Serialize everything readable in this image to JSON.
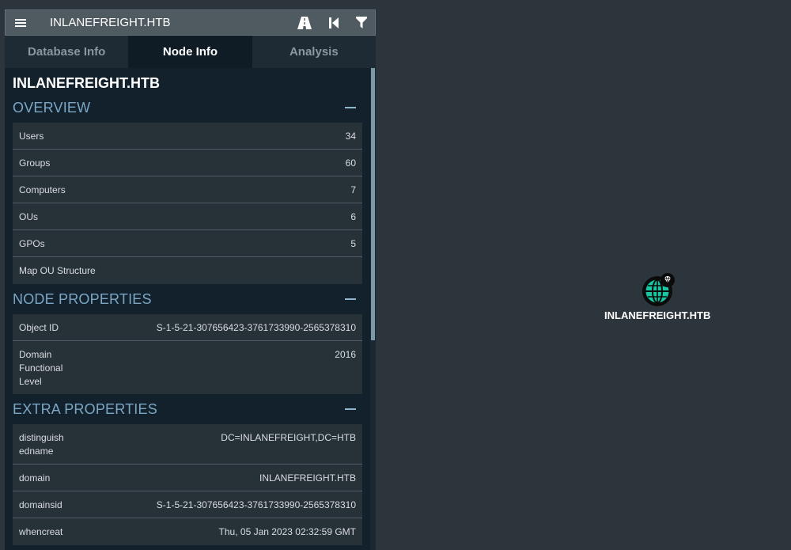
{
  "header": {
    "title": "INLANEFREIGHT.HTB",
    "icons": [
      "menu-icon",
      "path-finding-icon",
      "back-icon",
      "filter-icon"
    ]
  },
  "tabs": [
    {
      "label": "Database Info",
      "active": false
    },
    {
      "label": "Node Info",
      "active": true
    },
    {
      "label": "Analysis",
      "active": false
    }
  ],
  "node": {
    "name": "INLANEFREIGHT.HTB",
    "overview": {
      "header": "OVERVIEW",
      "rows": [
        {
          "label": "Users",
          "value": "34"
        },
        {
          "label": "Groups",
          "value": "60"
        },
        {
          "label": "Computers",
          "value": "7"
        },
        {
          "label": "OUs",
          "value": "6"
        },
        {
          "label": "GPOs",
          "value": "5"
        },
        {
          "label": "Map OU Structure",
          "value": ""
        }
      ]
    },
    "node_properties": {
      "header": "NODE PROPERTIES",
      "rows": [
        {
          "label": "Object ID",
          "value": "S-1-5-21-307656423-3761733990-2565378310"
        },
        {
          "label": "Domain Functional Level",
          "value": "2016"
        }
      ]
    },
    "extra_properties": {
      "header": "EXTRA PROPERTIES",
      "rows": [
        {
          "label": "distinguishedname",
          "value": "DC=INLANEFREIGHT,DC=HTB"
        },
        {
          "label": "domain",
          "value": "INLANEFREIGHT.HTB"
        },
        {
          "label": "domainsid",
          "value": "S-1-5-21-307656423-3761733990-2565378310"
        },
        {
          "label": "whencreat",
          "value": "Thu, 05 Jan 2023 02:32:59 GMT"
        }
      ]
    }
  },
  "graph": {
    "node_label": "INLANEFREIGHT.HTB",
    "node_icon": "globe-icon",
    "badge_icon": "diamond-icon",
    "node_color": "#17c6a3"
  }
}
